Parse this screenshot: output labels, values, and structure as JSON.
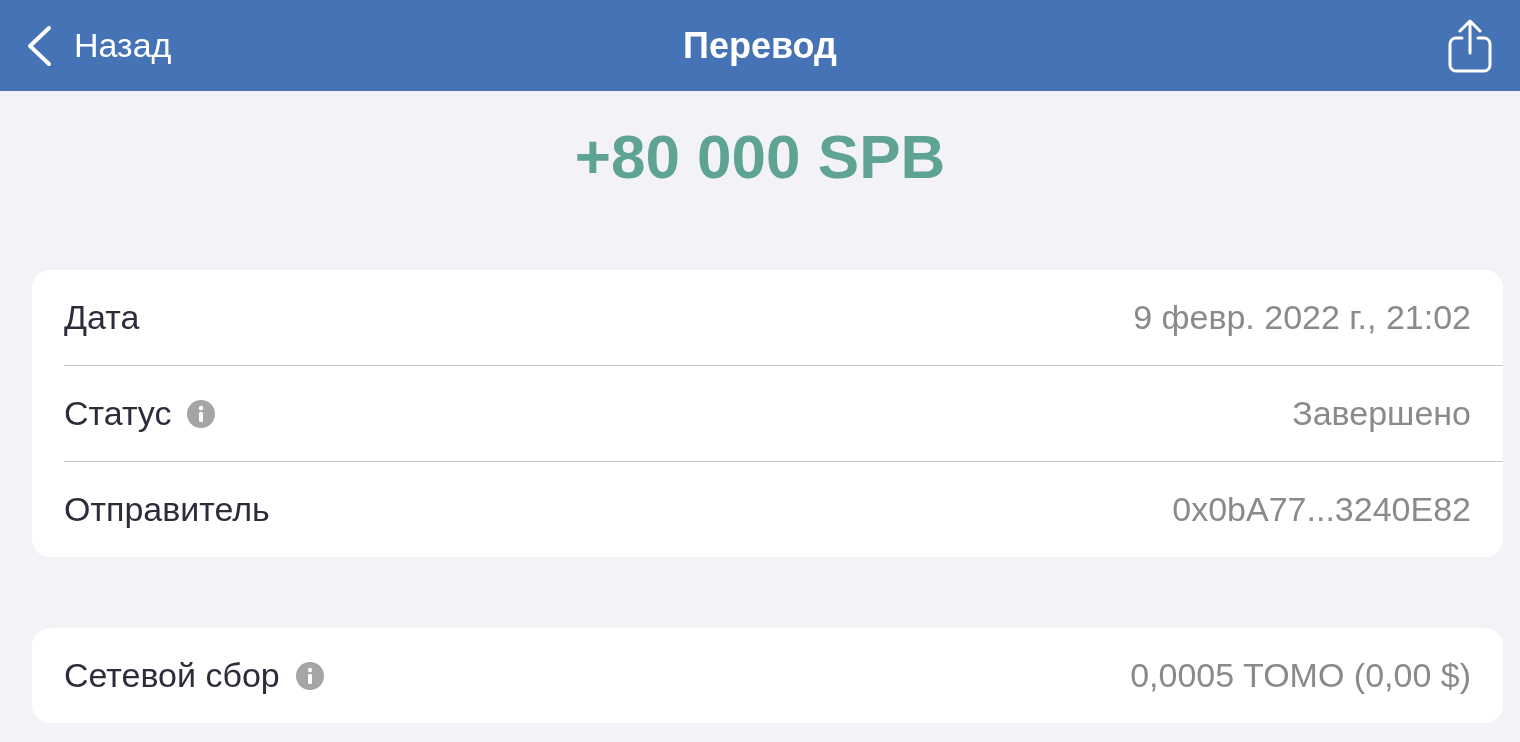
{
  "nav": {
    "back_label": "Назад",
    "title": "Перевод"
  },
  "amount": {
    "text": "+80 000 SPB",
    "kind": "incoming"
  },
  "sections": [
    {
      "rows": [
        {
          "label": "Дата",
          "value": "9 февр. 2022 г., 21:02",
          "info": false
        },
        {
          "label": "Статус",
          "value": "Завершено",
          "info": true
        },
        {
          "label": "Отправитель",
          "value": "0x0bA77...3240E82",
          "info": false
        }
      ]
    },
    {
      "rows": [
        {
          "label": "Сетевой сбор",
          "value": "0,0005 TOMO (0,00 $)",
          "info": true
        }
      ]
    }
  ]
}
